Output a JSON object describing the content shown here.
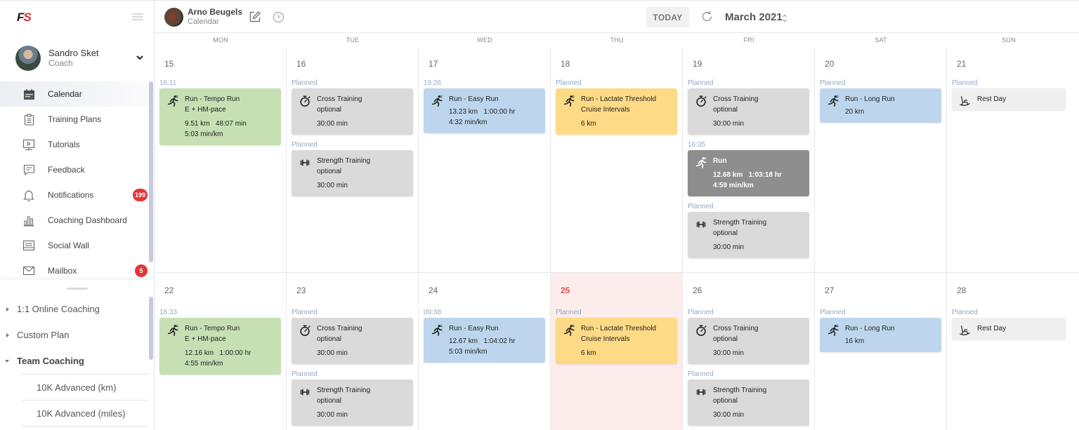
{
  "sidebar": {
    "logo": {
      "f": "F",
      "s": "S"
    },
    "user": {
      "name": "Sandro Sket",
      "role": "Coach"
    },
    "nav": [
      {
        "label": "Calendar",
        "icon": "calendar-icon",
        "active": true
      },
      {
        "label": "Training Plans",
        "icon": "clipboard-icon"
      },
      {
        "label": "Tutorials",
        "icon": "monitor-play-icon"
      },
      {
        "label": "Feedback",
        "icon": "chat-icon"
      },
      {
        "label": "Notifications",
        "icon": "bell-icon",
        "badge": "199"
      },
      {
        "label": "Coaching Dashboard",
        "icon": "bar-chart-icon"
      },
      {
        "label": "Social Wall",
        "icon": "wall-icon"
      },
      {
        "label": "Mailbox",
        "icon": "mail-icon",
        "badge": "5"
      }
    ],
    "groups": [
      {
        "label": "1:1 Online Coaching",
        "expanded": false
      },
      {
        "label": "Custom Plan",
        "expanded": false
      },
      {
        "label": "Team Coaching",
        "expanded": true,
        "children": [
          "10K Advanced (km)",
          "10K Advanced (miles)"
        ]
      }
    ]
  },
  "header": {
    "athlete_name": "Arno Beugels",
    "athlete_sub": "Calendar",
    "today_label": "TODAY",
    "month_label": "March 2021",
    "month_toggle": "⌃⌄"
  },
  "calendar": {
    "weekdays": [
      "MON",
      "TUE",
      "WED",
      "THU",
      "FRI",
      "SAT",
      "SUN"
    ],
    "weeks": [
      {
        "days": [
          {
            "num": "15",
            "events": [
              {
                "label": "16:11",
                "color": "green",
                "icon": "run",
                "title": "Run - Tempo Run",
                "sub": "E + HM-pace",
                "stats": "9.51 km   48:07 min",
                "stats2": "5:03 min/km"
              }
            ]
          },
          {
            "num": "16",
            "events": [
              {
                "label": "Planned",
                "color": "gray",
                "icon": "stopwatch",
                "title": "Cross Training",
                "sub": "optional",
                "stats": "30:00 min"
              },
              {
                "label": "Planned",
                "color": "gray",
                "icon": "dumbbell",
                "title": "Strength Training",
                "sub": "optional",
                "stats": "30:00 min"
              }
            ]
          },
          {
            "num": "17",
            "events": [
              {
                "label": "19:26",
                "color": "blue",
                "icon": "run",
                "title": "Run - Easy Run",
                "stats_inline": "13.23 km   1:00:00 hr",
                "stats2": "4:32 min/km"
              }
            ]
          },
          {
            "num": "18",
            "events": [
              {
                "label": "Planned",
                "color": "yellow",
                "icon": "run",
                "title": "Run - Lactate Threshold",
                "sub": "Cruise Intervals",
                "stats": "6 km"
              }
            ]
          },
          {
            "num": "19",
            "events": [
              {
                "label": "Planned",
                "color": "gray",
                "icon": "stopwatch",
                "title": "Cross Training",
                "sub": "optional",
                "stats": "30:00 min"
              },
              {
                "label": "16:35",
                "color": "dark",
                "icon": "run",
                "title": "Run",
                "stats": "12.68 km   1:03:18 hr",
                "stats2": "4:59 min/km"
              },
              {
                "label": "Planned",
                "color": "gray",
                "icon": "dumbbell",
                "title": "Strength Training",
                "sub": "optional",
                "stats": "30:00 min"
              }
            ]
          },
          {
            "num": "20",
            "events": [
              {
                "label": "Planned",
                "color": "blue",
                "icon": "run",
                "title": "Run - Long Run",
                "stats_inline": "20 km"
              }
            ]
          },
          {
            "num": "21",
            "events": [
              {
                "label": "Planned",
                "color": "light",
                "icon": "rocking-chair",
                "title": "Rest Day"
              }
            ]
          }
        ]
      },
      {
        "days": [
          {
            "num": "22",
            "events": [
              {
                "label": "16:33",
                "color": "green",
                "icon": "run",
                "title": "Run - Tempo Run",
                "sub": "E + HM-pace",
                "stats": "12.16 km   1:00:00 hr",
                "stats2": "4:55 min/km"
              }
            ]
          },
          {
            "num": "23",
            "events": [
              {
                "label": "Planned",
                "color": "gray",
                "icon": "stopwatch",
                "title": "Cross Training",
                "sub": "optional",
                "stats": "30:00 min"
              },
              {
                "label": "Planned",
                "color": "gray",
                "icon": "dumbbell",
                "title": "Strength Training",
                "sub": "optional",
                "stats": "30:00 min"
              }
            ]
          },
          {
            "num": "24",
            "events": [
              {
                "label": "09:38",
                "color": "blue",
                "icon": "run",
                "title": "Run - Easy Run",
                "stats_inline": "12.67 km   1:04:02 hr",
                "stats2": "5:03 min/km"
              }
            ]
          },
          {
            "num": "25",
            "today": true,
            "events": [
              {
                "label": "Planned",
                "color": "yellow",
                "icon": "run",
                "title": "Run - Lactate Threshold",
                "sub": "Cruise Intervals",
                "stats": "6 km"
              }
            ]
          },
          {
            "num": "26",
            "events": [
              {
                "label": "Planned",
                "color": "gray",
                "icon": "stopwatch",
                "title": "Cross Training",
                "sub": "optional",
                "stats": "30:00 min"
              },
              {
                "label": "Planned",
                "color": "gray",
                "icon": "dumbbell",
                "title": "Strength Training",
                "sub": "optional",
                "stats": "30:00 min"
              }
            ]
          },
          {
            "num": "27",
            "events": [
              {
                "label": "Planned",
                "color": "blue",
                "icon": "run",
                "title": "Run - Long Run",
                "stats_inline": "16 km"
              }
            ]
          },
          {
            "num": "28",
            "events": [
              {
                "label": "Planned",
                "color": "light",
                "icon": "rocking-chair",
                "title": "Rest Day"
              }
            ]
          }
        ]
      }
    ]
  },
  "colors": {
    "green": "#c6e0b3",
    "blue": "#bdd6ee",
    "yellow": "#fdda85",
    "gray": "#dadada",
    "dark": "#8e8e8e",
    "light": "#efefef",
    "today_bg": "#fdecec",
    "badge": "#e53535",
    "logo_red": "#e02b2b"
  }
}
